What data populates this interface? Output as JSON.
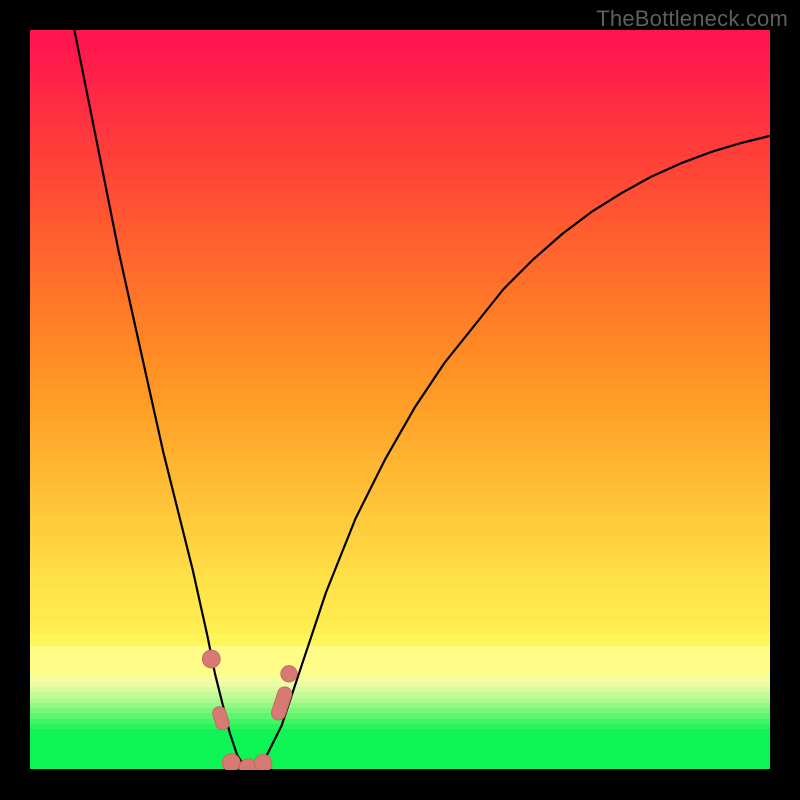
{
  "watermark": "TheBottleneck.com",
  "colors": {
    "black": "#000000",
    "marker": "#d77a74",
    "marker_stroke": "#c96861",
    "curve": "#000000"
  },
  "gradient_rows": [
    {
      "h": 10,
      "c": "#ff1550"
    },
    {
      "h": 10,
      "c": "#ff184e"
    },
    {
      "h": 10,
      "c": "#ff1b4c"
    },
    {
      "h": 10,
      "c": "#ff1e4a"
    },
    {
      "h": 10,
      "c": "#ff2248"
    },
    {
      "h": 10,
      "c": "#ff2646"
    },
    {
      "h": 10,
      "c": "#ff2a44"
    },
    {
      "h": 10,
      "c": "#ff2e42"
    },
    {
      "h": 10,
      "c": "#ff3240"
    },
    {
      "h": 10,
      "c": "#ff363e"
    },
    {
      "h": 10,
      "c": "#ff3a3c"
    },
    {
      "h": 10,
      "c": "#ff3e3a"
    },
    {
      "h": 10,
      "c": "#ff4238"
    },
    {
      "h": 10,
      "c": "#ff4636"
    },
    {
      "h": 10,
      "c": "#ff4a34"
    },
    {
      "h": 10,
      "c": "#ff4e33"
    },
    {
      "h": 10,
      "c": "#ff5232"
    },
    {
      "h": 10,
      "c": "#ff5631"
    },
    {
      "h": 10,
      "c": "#ff5a30"
    },
    {
      "h": 10,
      "c": "#ff5e2f"
    },
    {
      "h": 10,
      "c": "#ff622e"
    },
    {
      "h": 10,
      "c": "#ff662d"
    },
    {
      "h": 10,
      "c": "#ff6a2c"
    },
    {
      "h": 10,
      "c": "#ff6e2b"
    },
    {
      "h": 10,
      "c": "#ff722a"
    },
    {
      "h": 10,
      "c": "#ff7629"
    },
    {
      "h": 10,
      "c": "#ff7a28"
    },
    {
      "h": 10,
      "c": "#ff7e27"
    },
    {
      "h": 10,
      "c": "#ff8226"
    },
    {
      "h": 10,
      "c": "#ff8625"
    },
    {
      "h": 10,
      "c": "#ff8a24"
    },
    {
      "h": 10,
      "c": "#ff8e24"
    },
    {
      "h": 10,
      "c": "#ff9224"
    },
    {
      "h": 10,
      "c": "#ff9625"
    },
    {
      "h": 10,
      "c": "#ff9a26"
    },
    {
      "h": 10,
      "c": "#ff9e27"
    },
    {
      "h": 10,
      "c": "#ffa228"
    },
    {
      "h": 10,
      "c": "#ffa62a"
    },
    {
      "h": 10,
      "c": "#ffaa2c"
    },
    {
      "h": 10,
      "c": "#ffae2e"
    },
    {
      "h": 10,
      "c": "#ffb230"
    },
    {
      "h": 10,
      "c": "#ffb632"
    },
    {
      "h": 10,
      "c": "#ffba34"
    },
    {
      "h": 10,
      "c": "#ffbe36"
    },
    {
      "h": 10,
      "c": "#ffc238"
    },
    {
      "h": 10,
      "c": "#ffc63a"
    },
    {
      "h": 10,
      "c": "#ffca3c"
    },
    {
      "h": 10,
      "c": "#ffce3e"
    },
    {
      "h": 10,
      "c": "#ffd240"
    },
    {
      "h": 10,
      "c": "#ffd642"
    },
    {
      "h": 10,
      "c": "#ffda44"
    },
    {
      "h": 10,
      "c": "#ffde46"
    },
    {
      "h": 10,
      "c": "#ffe148"
    },
    {
      "h": 10,
      "c": "#ffe44a"
    },
    {
      "h": 10,
      "c": "#ffe74c"
    },
    {
      "h": 10,
      "c": "#ffea4e"
    },
    {
      "h": 12,
      "c": "#ffee52"
    },
    {
      "h": 12,
      "c": "#fff458"
    },
    {
      "h": 28,
      "c": "#fffc88"
    },
    {
      "h": 6,
      "c": "#f6fca0"
    },
    {
      "h": 5,
      "c": "#eafca6"
    },
    {
      "h": 5,
      "c": "#d8fba0"
    },
    {
      "h": 5,
      "c": "#c4fa98"
    },
    {
      "h": 5,
      "c": "#aef98e"
    },
    {
      "h": 5,
      "c": "#96f884"
    },
    {
      "h": 5,
      "c": "#7af778"
    },
    {
      "h": 5,
      "c": "#5ef66e"
    },
    {
      "h": 5,
      "c": "#42f564"
    },
    {
      "h": 5,
      "c": "#28f45c"
    },
    {
      "h": 8,
      "c": "#14f356"
    },
    {
      "h": 30,
      "c": "#0df455"
    }
  ],
  "chart_data": {
    "type": "line",
    "title": "",
    "xlabel": "",
    "ylabel": "",
    "xlim": [
      0,
      100
    ],
    "ylim": [
      0,
      100
    ],
    "note": "Values are read in a 0–100 coordinate space: x runs left→right, y runs bottom→top, matching the plot area.",
    "series": [
      {
        "name": "bottleneck-curve",
        "x": [
          6,
          8,
          10,
          12,
          14,
          16,
          18,
          20,
          22,
          24,
          25,
          26,
          27,
          28,
          29,
          30,
          31,
          32,
          34,
          36,
          38,
          40,
          44,
          48,
          52,
          56,
          60,
          64,
          68,
          72,
          76,
          80,
          84,
          88,
          92,
          96,
          100
        ],
        "y": [
          100,
          90,
          80,
          70,
          61,
          52,
          43,
          35,
          27,
          18,
          13,
          9,
          5,
          2,
          0.5,
          0.2,
          0.5,
          2,
          6,
          12,
          18,
          24,
          34,
          42,
          49,
          55,
          60,
          65,
          69,
          72.5,
          75.5,
          78,
          80.2,
          82,
          83.5,
          84.7,
          85.7
        ]
      }
    ],
    "markers": [
      {
        "name": "left-upper-dot",
        "shape": "circle",
        "x": 24.5,
        "y": 15,
        "r": 1.2
      },
      {
        "name": "left-mid-capsule",
        "shape": "capsule",
        "x": 25.8,
        "y": 7,
        "w": 1.8,
        "h": 3.2,
        "angle": -18
      },
      {
        "name": "bottom-left-dot",
        "shape": "circle",
        "x": 27.2,
        "y": 1.0,
        "r": 1.2
      },
      {
        "name": "bottom-mid-dot",
        "shape": "circle",
        "x": 29.5,
        "y": 0.3,
        "r": 1.2
      },
      {
        "name": "bottom-right-dot",
        "shape": "circle",
        "x": 31.5,
        "y": 0.9,
        "r": 1.2
      },
      {
        "name": "right-capsule",
        "shape": "capsule",
        "x": 34.0,
        "y": 9,
        "w": 1.9,
        "h": 4.6,
        "angle": 18
      },
      {
        "name": "right-upper-dot",
        "shape": "circle",
        "x": 35.0,
        "y": 13,
        "r": 1.1
      }
    ]
  }
}
